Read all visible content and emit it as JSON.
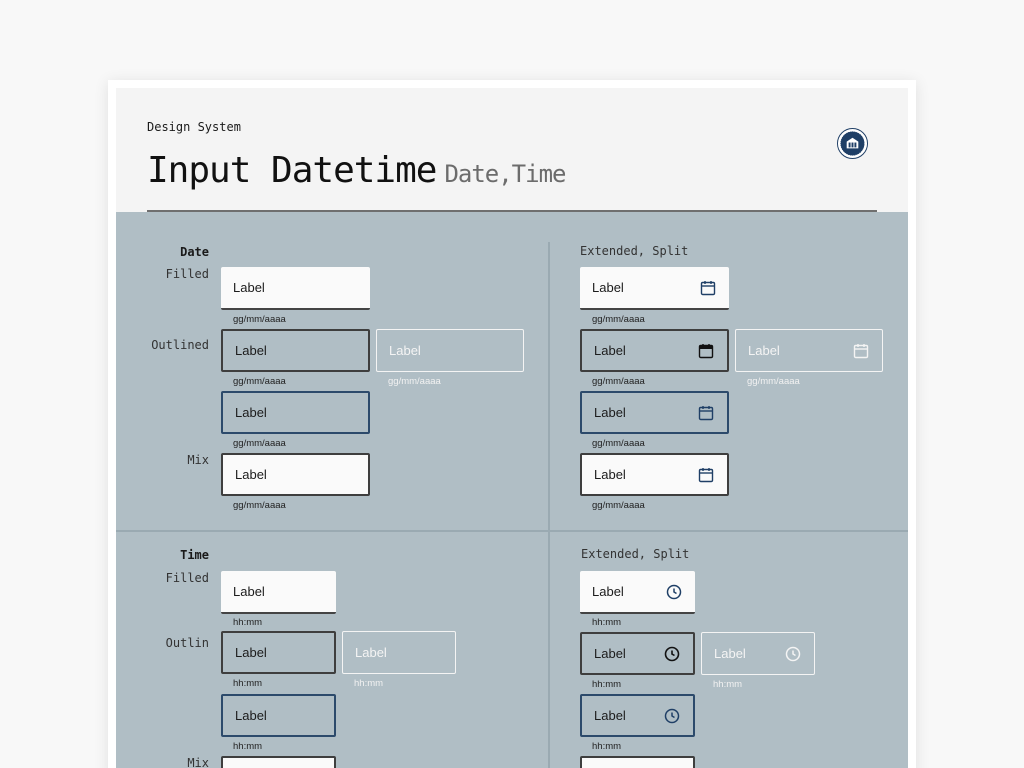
{
  "header": {
    "eyebrow": "Design System",
    "title": "Input Datetime",
    "subtitle": "Date,Time"
  },
  "date_section": {
    "title": "Date",
    "filled_label": "Filled",
    "outlined_label": "Outlined",
    "mix_label": "Mix",
    "extended_title": "Extended, Split",
    "field_label": "Label",
    "helper": "gg/mm/aaaa"
  },
  "time_section": {
    "title": "Time",
    "filled_label": "Filled",
    "outlined_label": "Outlin",
    "mix_label": "Mix",
    "extended_title": "Extended, Split",
    "field_label": "Label",
    "helper": "hh:mm"
  },
  "icons": {
    "calendar": "calendar-icon",
    "clock": "clock-icon",
    "seal": "seal-logo"
  },
  "colors": {
    "panel": "#b0bec5",
    "header": "#f4f4f4",
    "focus_border": "#2c4a6b",
    "icon_blue": "#1f3f66"
  }
}
